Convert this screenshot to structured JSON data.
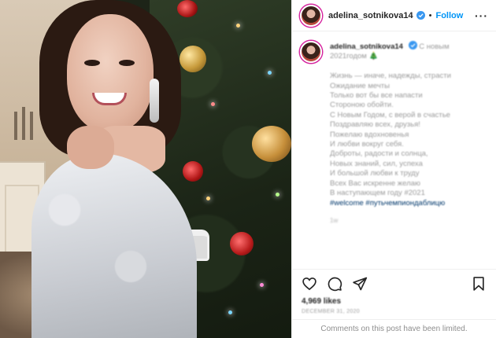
{
  "header": {
    "username": "adelina_sotnikova14",
    "separator": "•",
    "follow_label": "Follow",
    "more_label": "···"
  },
  "caption": {
    "username": "adelina_sotnikova14",
    "intro": "С новым 2021годом 🎄",
    "lines": [
      "Жизнь — иначе, надежды, страсти",
      "Ожидание мечты",
      "Только вот бы все напасти",
      "Стороною обойти.",
      "С Новым Годом, с верой в счастье",
      "Поздравляю всех, друзья!",
      "Пожелаю вдохновенья",
      "И любви вокруг себя.",
      "Доброты, радости и солнца,",
      "Новых знаний, сил, успеха",
      "И большой любви к труду",
      "Всех Вас искренне желаю",
      "В наступающем году #2021"
    ],
    "tags": "#welcome #путьчемпиондаблицю",
    "time": "1w"
  },
  "likes": "4,969 likes",
  "date": "DECEMBER 31, 2020",
  "comments_limited": "Comments on this post have been limited.",
  "icons": {
    "verified": "verified-badge-icon",
    "like": "heart-icon",
    "comment": "comment-icon",
    "share": "paper-plane-icon",
    "save": "bookmark-icon",
    "more": "more-options-icon"
  },
  "colors": {
    "follow": "#0095f6",
    "verified": "#3897f0",
    "story_ring": "#d6249f"
  }
}
